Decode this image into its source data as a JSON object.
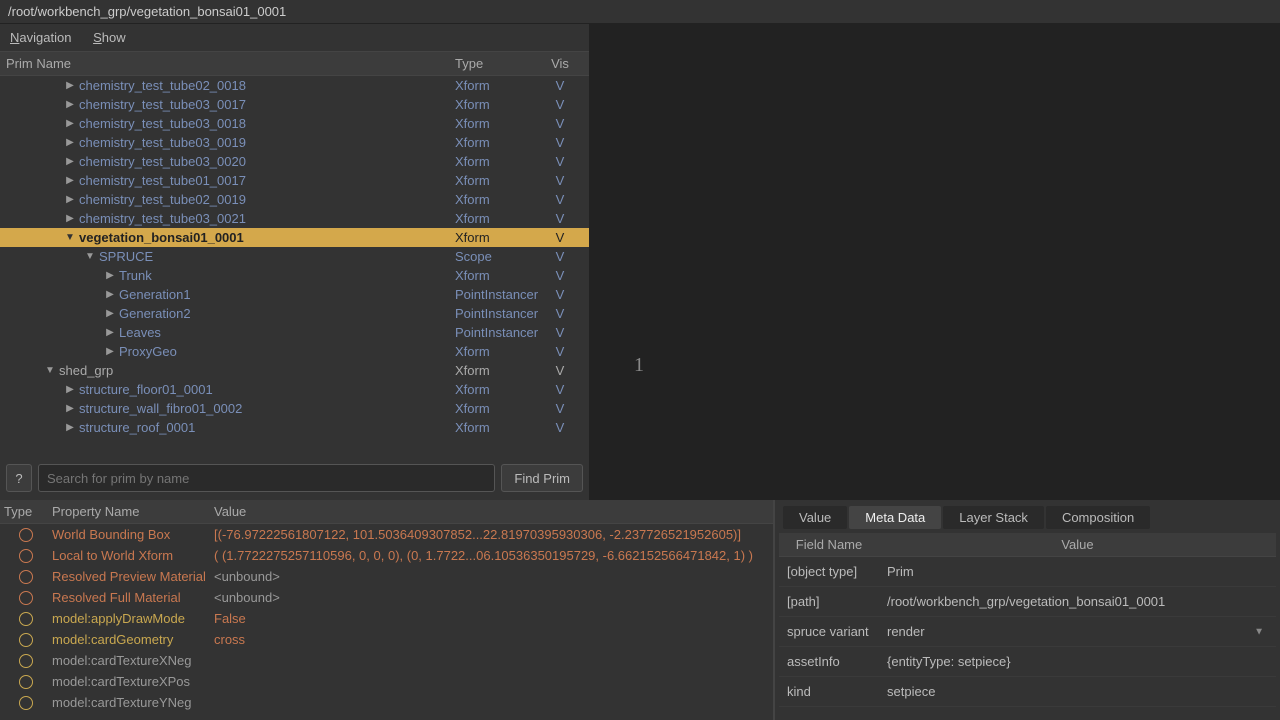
{
  "path": "/root/workbench_grp/vegetation_bonsai01_0001",
  "menu": {
    "navigation": "Navigation",
    "show": "Show"
  },
  "tree": {
    "headers": {
      "name": "Prim Name",
      "type": "Type",
      "vis": "Vis"
    },
    "rows": [
      {
        "indent": 65,
        "arrow": "▶",
        "name": "chemistry_test_tube02_0018",
        "type": "Xform",
        "vis": "V",
        "style": "link"
      },
      {
        "indent": 65,
        "arrow": "▶",
        "name": "chemistry_test_tube03_0017",
        "type": "Xform",
        "vis": "V",
        "style": "link"
      },
      {
        "indent": 65,
        "arrow": "▶",
        "name": "chemistry_test_tube03_0018",
        "type": "Xform",
        "vis": "V",
        "style": "link"
      },
      {
        "indent": 65,
        "arrow": "▶",
        "name": "chemistry_test_tube03_0019",
        "type": "Xform",
        "vis": "V",
        "style": "link"
      },
      {
        "indent": 65,
        "arrow": "▶",
        "name": "chemistry_test_tube03_0020",
        "type": "Xform",
        "vis": "V",
        "style": "link"
      },
      {
        "indent": 65,
        "arrow": "▶",
        "name": "chemistry_test_tube01_0017",
        "type": "Xform",
        "vis": "V",
        "style": "link"
      },
      {
        "indent": 65,
        "arrow": "▶",
        "name": "chemistry_test_tube02_0019",
        "type": "Xform",
        "vis": "V",
        "style": "link"
      },
      {
        "indent": 65,
        "arrow": "▶",
        "name": "chemistry_test_tube03_0021",
        "type": "Xform",
        "vis": "V",
        "style": "link"
      },
      {
        "indent": 65,
        "arrow": "▼",
        "name": "vegetation_bonsai01_0001",
        "type": "Xform",
        "vis": "V",
        "style": "link",
        "selected": true
      },
      {
        "indent": 85,
        "arrow": "▼",
        "name": "SPRUCE",
        "type": "Scope",
        "vis": "V",
        "style": "link"
      },
      {
        "indent": 105,
        "arrow": "▶",
        "name": "Trunk",
        "type": "Xform",
        "vis": "V",
        "style": "link"
      },
      {
        "indent": 105,
        "arrow": "▶",
        "name": "Generation1",
        "type": "PointInstancer",
        "vis": "V",
        "style": "link"
      },
      {
        "indent": 105,
        "arrow": "▶",
        "name": "Generation2",
        "type": "PointInstancer",
        "vis": "V",
        "style": "link"
      },
      {
        "indent": 105,
        "arrow": "▶",
        "name": "Leaves",
        "type": "PointInstancer",
        "vis": "V",
        "style": "link"
      },
      {
        "indent": 105,
        "arrow": "▶",
        "name": "ProxyGeo",
        "type": "Xform",
        "vis": "V",
        "style": "link"
      },
      {
        "indent": 45,
        "arrow": "▼",
        "name": "shed_grp",
        "type": "Xform",
        "vis": "V",
        "style": "plain"
      },
      {
        "indent": 65,
        "arrow": "▶",
        "name": "structure_floor01_0001",
        "type": "Xform",
        "vis": "V",
        "style": "link"
      },
      {
        "indent": 65,
        "arrow": "▶",
        "name": "structure_wall_fibro01_0002",
        "type": "Xform",
        "vis": "V",
        "style": "link"
      },
      {
        "indent": 65,
        "arrow": "▶",
        "name": "structure_roof_0001",
        "type": "Xform",
        "vis": "V",
        "style": "link"
      }
    ]
  },
  "search": {
    "help": "?",
    "placeholder": "Search for prim by name",
    "button": "Find Prim"
  },
  "viewport": {
    "label": "1"
  },
  "props": {
    "headers": {
      "type": "Type",
      "name": "Property Name",
      "value": "Value"
    },
    "rows": [
      {
        "icon": "c",
        "name": "World Bounding Box",
        "nameStyle": "comp",
        "value": "[(-76.97222561807122, 101.5036409307852...22.81970395930306, -2.237726521952605)]",
        "valStyle": "comp"
      },
      {
        "icon": "c",
        "name": "Local to World Xform",
        "nameStyle": "comp",
        "value": "( (1.7722275257110596, 0, 0, 0), (0, 1.7722...06.10536350195729, -6.662152566471842, 1) )",
        "valStyle": "comp"
      },
      {
        "icon": "c",
        "name": "Resolved Preview Material",
        "nameStyle": "comp",
        "value": "<unbound>",
        "valStyle": "plain"
      },
      {
        "icon": "c",
        "name": "Resolved Full Material",
        "nameStyle": "comp",
        "value": "<unbound>",
        "valStyle": "plain"
      },
      {
        "icon": "a",
        "name": "model:applyDrawMode",
        "nameStyle": "attr",
        "value": "False",
        "valStyle": "comp"
      },
      {
        "icon": "a",
        "name": "model:cardGeometry",
        "nameStyle": "attr",
        "value": "cross",
        "valStyle": "comp"
      },
      {
        "icon": "a",
        "name": "model:cardTextureXNeg",
        "nameStyle": "plain",
        "value": "",
        "valStyle": "plain"
      },
      {
        "icon": "a",
        "name": "model:cardTextureXPos",
        "nameStyle": "plain",
        "value": "",
        "valStyle": "plain"
      },
      {
        "icon": "a",
        "name": "model:cardTextureYNeg",
        "nameStyle": "plain",
        "value": "",
        "valStyle": "plain"
      }
    ]
  },
  "tabs": {
    "items": [
      "Value",
      "Meta Data",
      "Layer Stack",
      "Composition"
    ],
    "active": 1
  },
  "meta": {
    "headers": {
      "field": "Field Name",
      "value": "Value"
    },
    "rows": [
      {
        "field": "[object type]",
        "value": "Prim"
      },
      {
        "field": "[path]",
        "value": "/root/workbench_grp/vegetation_bonsai01_0001"
      },
      {
        "field": "spruce variant",
        "value": "render",
        "dropdown": true
      },
      {
        "field": "assetInfo",
        "value": "{entityType: setpiece}"
      },
      {
        "field": "kind",
        "value": "setpiece"
      }
    ]
  }
}
